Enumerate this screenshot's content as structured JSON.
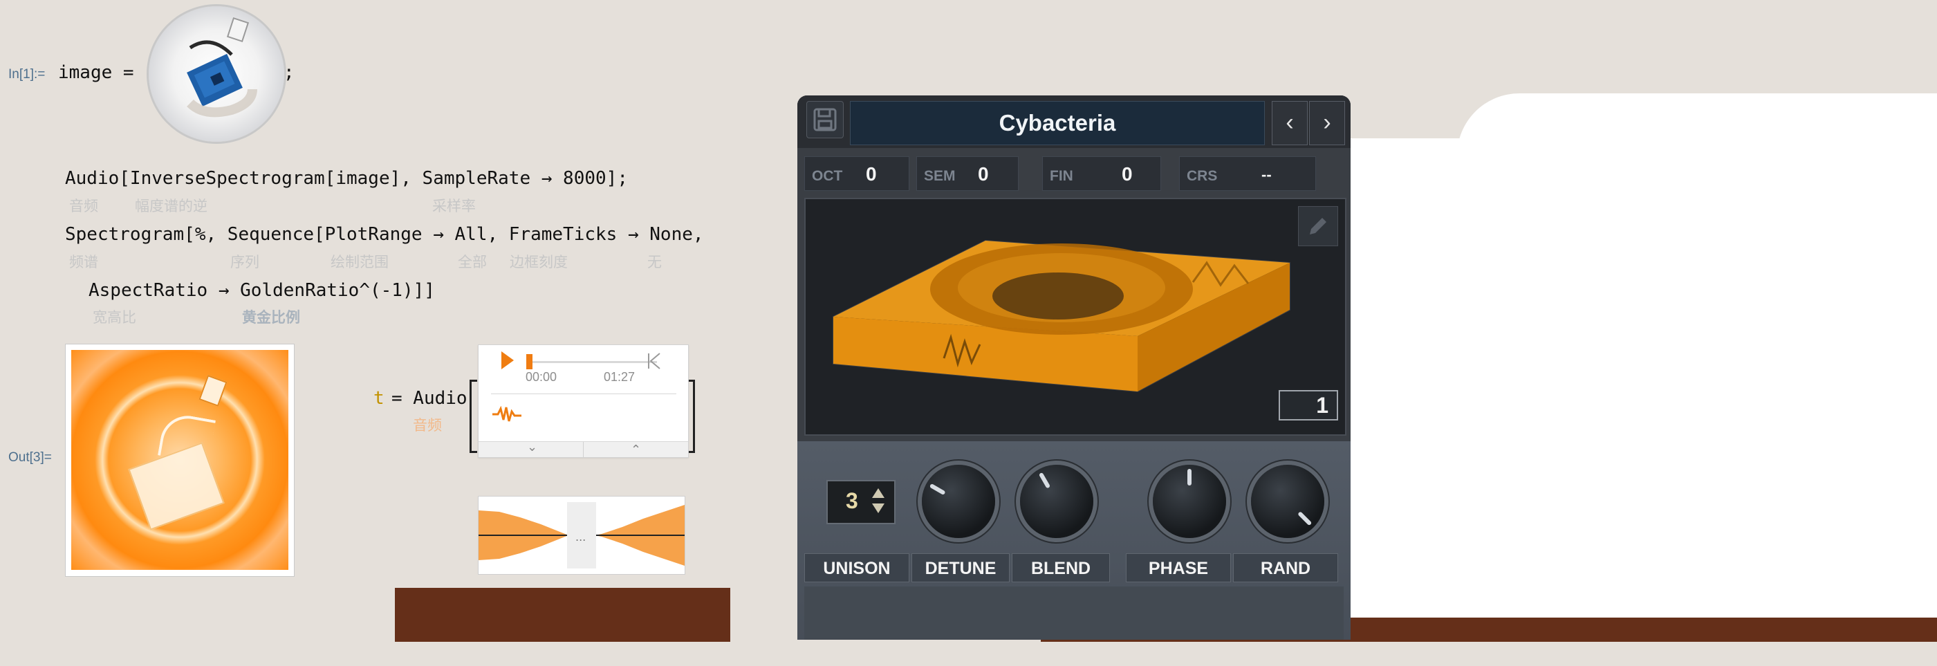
{
  "notebook": {
    "in1_label": "In[1]:=",
    "in1_code_left": "image =",
    "in1_code_right": ";",
    "line2_code": "Audio[InverseSpectrogram[image], SampleRate → 8000];",
    "line2_glosses": [
      "音频",
      "幅度谱的逆",
      "采样率"
    ],
    "line3_code": "Spectrogram[%, Sequence[PlotRange → All, FrameTicks → None,",
    "line3_glosses": [
      "频谱",
      "序列",
      "绘制范围",
      "全部",
      "边框刻度",
      "无"
    ],
    "line4_code": "AspectRatio → GoldenRatio^(-1)]]",
    "line4_glosses": [
      "宽高比",
      "黄金比例"
    ],
    "out3_label": "Out[3]=",
    "t_assign_left": "t",
    "t_assign_right": "= Audio",
    "t_gloss": "音频",
    "audio_widget": {
      "time_start": "00:00",
      "time_end": "01:27",
      "progress": 0.0
    }
  },
  "synth": {
    "preset_name": "Cybacteria",
    "prev_label": "‹",
    "next_label": "›",
    "params": [
      {
        "label": "OCT",
        "value": "0"
      },
      {
        "label": "SEM",
        "value": "0"
      },
      {
        "label": "FIN",
        "value": "0"
      },
      {
        "label": "CRS",
        "value": "--"
      }
    ],
    "frame_number": "1",
    "unison_value": "3",
    "tabs": [
      "UNISON",
      "DETUNE",
      "BLEND",
      "PHASE",
      "RAND"
    ],
    "colors": {
      "accent": "#f7a21a",
      "panel": "#3a3e44",
      "preset_bg": "#1b2b3b"
    }
  },
  "icons": [
    "save-icon",
    "pencil-icon",
    "play-icon",
    "skip-to-end-icon",
    "waveform-icon",
    "chevron-down-icon",
    "chevron-up-icon"
  ]
}
